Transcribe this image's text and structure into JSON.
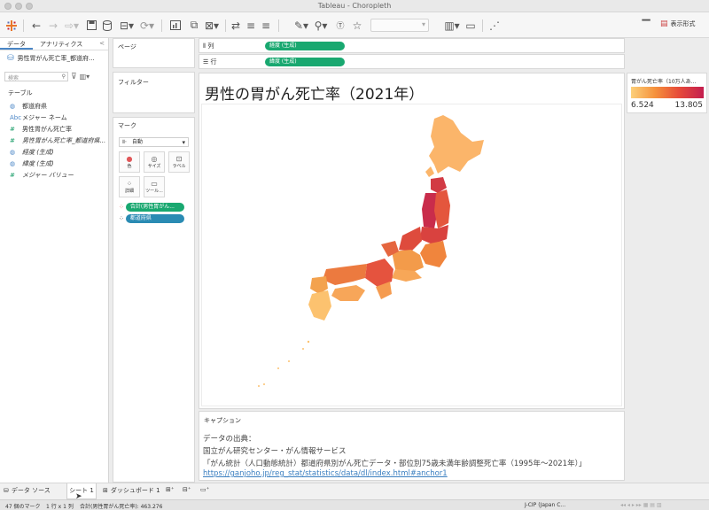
{
  "window": {
    "title": "Tableau - Choropleth"
  },
  "toolbar": {
    "show_me": "表示形式"
  },
  "left_panel": {
    "tabs": [
      "データ",
      "アナリティクス"
    ],
    "collapse": "<",
    "data_source": "男性胃がん死亡率_都道府...",
    "search_placeholder": "検索",
    "section_label": "テーブル",
    "fields": [
      {
        "icon": "globe-icon",
        "glyph": "◍",
        "name": "都道府県"
      },
      {
        "icon": "abc-icon",
        "glyph": "Abc",
        "name": "メジャー ネーム"
      },
      {
        "icon": "hash-icon",
        "glyph": "#",
        "name": "男性胃がん死亡率"
      },
      {
        "icon": "hash-icon",
        "glyph": "#",
        "name": "男性胃がん死亡率_都道府県..."
      },
      {
        "icon": "globe-icon",
        "glyph": "◍",
        "name": "経度 (生成)"
      },
      {
        "icon": "globe-icon",
        "glyph": "◍",
        "name": "緯度 (生成)"
      },
      {
        "icon": "hash-icon",
        "glyph": "#",
        "name": "メジャー バリュー"
      }
    ]
  },
  "cards": {
    "pages": "ページ",
    "filters": "フィルター",
    "marks": "マーク",
    "mark_type": "自動",
    "mark_buttons": [
      "色",
      "サイズ",
      "ラベル",
      "詳細",
      "ツール..."
    ],
    "mark_pills": [
      "合計(男性胃がん...",
      "都道府県"
    ]
  },
  "shelves": {
    "columns_label": "列",
    "rows_label": "行",
    "columns_pill": "経度 (生成)",
    "rows_pill": "緯度 (生成)"
  },
  "viz": {
    "title": "男性の胃がん死亡率（2021年）"
  },
  "legend": {
    "title": "胃がん死亡率（10万人あ...",
    "min": "6.524",
    "max": "13.805",
    "colors": {
      "low": "#fcd07a",
      "mid": "#f5913c",
      "high": "#e6493a",
      "top": "#c31e4f"
    }
  },
  "caption": {
    "title": "キャプション",
    "lines": [
      "データの出典：",
      "国立がん研究センター・がん情報サービス",
      "「がん統計（人口動態統計）都道府県別がん死亡データ・部位別75歳未満年齢調整死亡率（1995年～2021年）」"
    ],
    "link": "https://ganjoho.jp/reg_stat/statistics/data/dl/index.html#anchor1"
  },
  "tabs": {
    "data_source": "データ ソース",
    "sheet": "シート 1",
    "dashboard": "ダッシュボード 1"
  },
  "status": {
    "marks": "47 個のマーク",
    "grid": "1 行 x 1 列",
    "sum": "合計(男性胃がん死亡率): 463.276",
    "locale": "J-CIP (Japan C..."
  }
}
